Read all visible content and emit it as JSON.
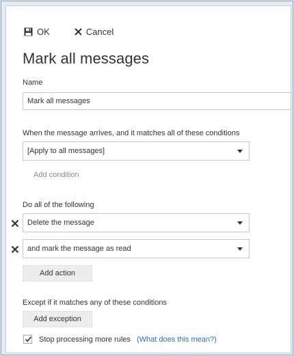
{
  "toolbar": {
    "ok_label": "OK",
    "cancel_label": "Cancel"
  },
  "page_title": "Mark all messages",
  "name_section": {
    "label": "Name",
    "value": "Mark all messages"
  },
  "conditions_section": {
    "label": "When the message arrives, and it matches all of these conditions",
    "selected": "[Apply to all messages]",
    "add_link": "Add condition"
  },
  "actions_section": {
    "label": "Do all of the following",
    "actions": [
      {
        "selected": "Delete the message"
      },
      {
        "selected": "and mark the message as read"
      }
    ],
    "add_button": "Add action"
  },
  "exceptions_section": {
    "label": "Except if it matches any of these conditions",
    "add_button": "Add exception"
  },
  "stop_processing": {
    "checked": true,
    "label": "Stop processing more rules",
    "help_link": "(What does this mean?)"
  },
  "icons": {
    "save": "save-icon",
    "cancel": "close-icon",
    "remove": "close-icon",
    "dropdown": "chevron-down-icon",
    "check": "checkmark-icon"
  },
  "colors": {
    "link": "#2b6cb8",
    "muted_text": "#8a8a8a",
    "button_bg": "#ededed",
    "border": "#c8c8c8"
  }
}
